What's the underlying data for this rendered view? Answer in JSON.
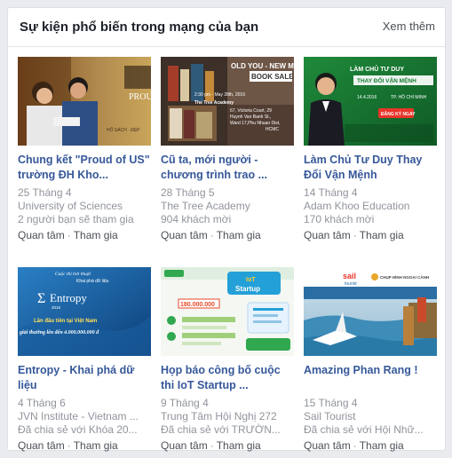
{
  "panel": {
    "title": "Sự kiện phổ biến trong mạng của bạn",
    "see_more": "Xem thêm"
  },
  "events": [
    {
      "title": "Chung kết \"Proud of US\" trường ĐH Kho...",
      "date": "25 Tháng 4",
      "host": "University of Sciences",
      "stat": "2 người bạn sẽ tham gia",
      "interested": "Quan tâm",
      "going": "Tham gia",
      "thumb_text": [
        "PROUD",
        "HỐ SÁCH · ĐẸP"
      ]
    },
    {
      "title": "Cũ ta, mới người - chương trình trao ...",
      "date": "28 Tháng 5",
      "host": "The Tree Academy",
      "stat": "904 khách mời",
      "interested": "Quan tâm",
      "going": "Tham gia",
      "thumb_text": [
        "OLD YOU - NEW ME:",
        "BOOK SALE",
        "2:30 pm - May 28th, 2016",
        "The Tree Academy",
        "67, Victoria Court, 29",
        "Huynh Van Banh St.,",
        "Ward 17,Phu Nhuan Dist,",
        "HCMC"
      ]
    },
    {
      "title": "Làm Chủ Tư Duy Thay Đổi Vận Mệnh",
      "date": "14 Tháng 4",
      "host": "Adam Khoo Education",
      "stat": "170 khách mời",
      "interested": "Quan tâm",
      "going": "Tham gia",
      "thumb_text": [
        "LÀM CHỦ TƯ DUY",
        "THAY ĐỔI VẬN MỆNH",
        "14.4.2016",
        "TP. HỒ CHÍ MINH",
        "ĐĂNG KÝ NGAY"
      ]
    },
    {
      "title": "Entropy - Khai phá dữ liệu",
      "date": "4 Tháng 6",
      "host": "JVN Institute - Vietnam ...",
      "stat": "Đã chia sẻ với Khóa 20...",
      "interested": "Quan tâm",
      "going": "Tham gia",
      "thumb_text": [
        "Cuộc thi bơi thuật",
        "Khai phá dữ liệu",
        "Entropy",
        "2016",
        "Lần đầu tiên tại Việt Nam",
        "giải thưởng lên đến 4.000.000.000 đ"
      ]
    },
    {
      "title": "Họp báo công bố cuộc thi IoT Startup ...",
      "date": "9 Tháng 4",
      "host": "Trung Tâm Hội Nghị 272",
      "stat": "Đã chia sẻ với TRƯỜN...",
      "interested": "Quan tâm",
      "going": "Tham gia",
      "thumb_text": [
        "IoT",
        "Startup",
        "180.000.000"
      ]
    },
    {
      "title": "Amazing Phan Rang !",
      "date": "15 Tháng 4",
      "host": "Sail Tourist",
      "stat": "Đã chia sẻ với Hội Nhữ...",
      "interested": "Quan tâm",
      "going": "Tham gia",
      "thumb_text": [
        "sail",
        "tourist",
        "CHỤP HÌNH NGOẠI CẢNH"
      ]
    }
  ],
  "colors": {
    "link": "#365899",
    "meta": "#90949c",
    "action": "#4b4f56"
  }
}
